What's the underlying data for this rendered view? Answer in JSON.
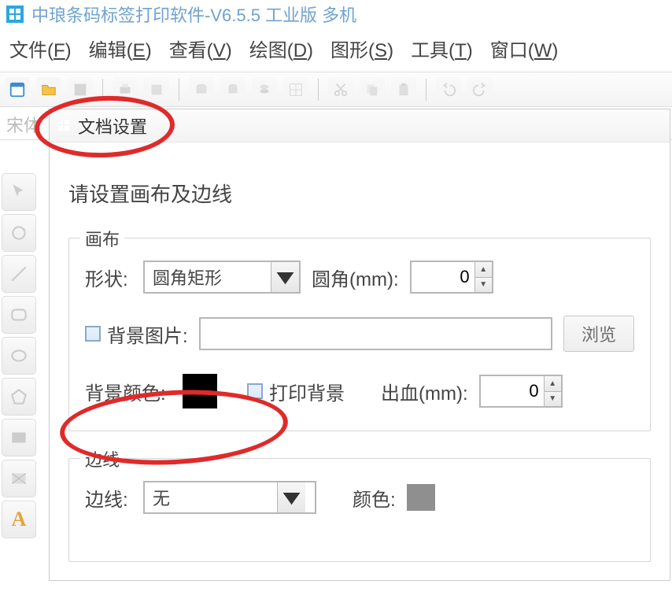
{
  "title": "中琅条码标签打印软件-V6.5.5 工业版 多机",
  "menubar": {
    "file": "文件(",
    "file_m": "F",
    "file2": ")",
    "edit": "编辑(",
    "edit_m": "E",
    "edit2": ")",
    "view": "查看(",
    "view_m": "V",
    "view2": ")",
    "draw": "绘图(",
    "draw_m": "D",
    "draw2": ")",
    "shape": "图形(",
    "shape_m": "S",
    "shape2": ")",
    "tools": "工具(",
    "tools_m": "T",
    "tools2": ")",
    "window": "窗口(",
    "window_m": "W",
    "window2": ")"
  },
  "fontrow": {
    "font_name": "宋体"
  },
  "dialog": {
    "title": "文档设置",
    "heading": "请设置画布及边线",
    "group_canvas": "画布",
    "group_border": "边线",
    "shape_label": "形状:",
    "shape_value": "圆角矩形",
    "radius_label": "圆角(mm):",
    "radius_value": "0",
    "bgimage_check": "背景图片:",
    "browse": "浏览",
    "bgcolor_label": "背景颜色:",
    "printbg_check": "打印背景",
    "bleed_label": "出血(mm):",
    "bleed_value": "0",
    "border_label": "边线:",
    "border_value": "无",
    "color_label": "颜色:"
  }
}
